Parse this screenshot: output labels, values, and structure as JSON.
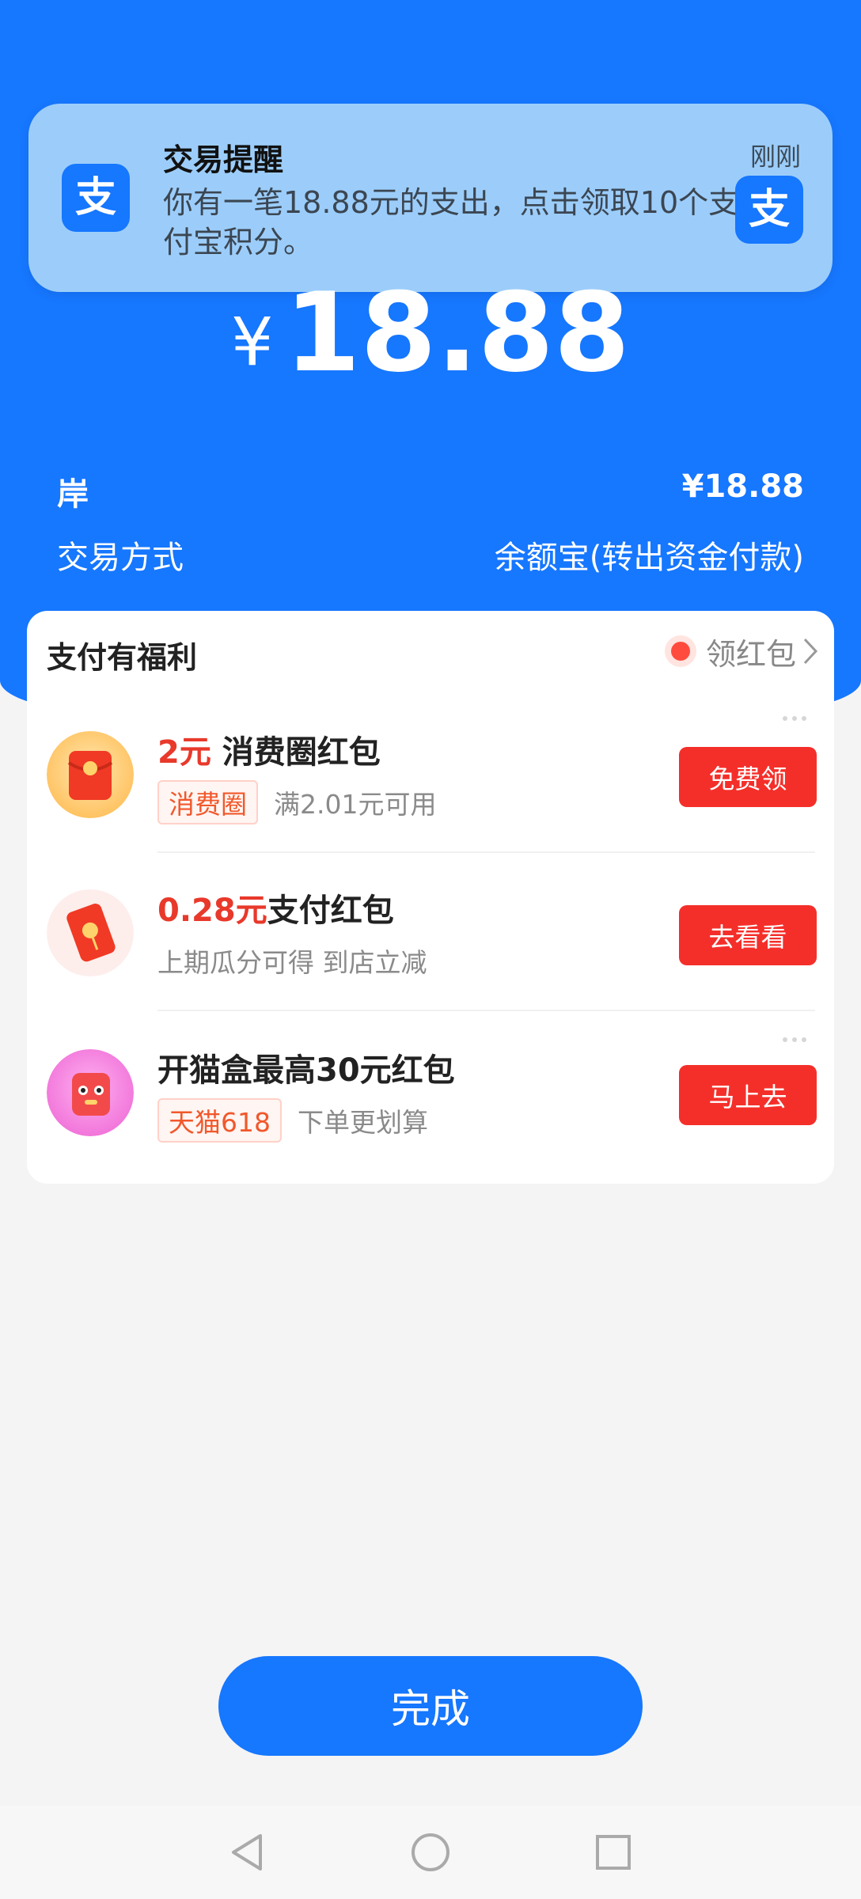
{
  "notification": {
    "app_icon": "alipay-icon",
    "title": "交易提醒",
    "time": "刚刚",
    "body": "你有一笔18.88元的支出，点击领取10个支付宝积分。"
  },
  "amount": {
    "currency": "¥",
    "value": "18.88"
  },
  "details": {
    "row1_label": "岸",
    "row1_value": "¥18.88",
    "row2_label": "交易方式",
    "row2_value": "余额宝(转出资金付款)"
  },
  "benefits": {
    "title": "支付有福利",
    "link_label": "领红包",
    "items": [
      {
        "amount": "2元",
        "title": " 消费圈红包",
        "tag": "消费圈",
        "desc": "满2.01元可用",
        "button": "免费领"
      },
      {
        "amount": "0.28元",
        "title": "支付红包",
        "tag": "",
        "desc": "上期瓜分可得 到店立减",
        "button": "去看看"
      },
      {
        "amount": "",
        "title": "开猫盒最高30元红包",
        "tag": "天猫618",
        "desc": "下单更划算",
        "button": "马上去"
      }
    ]
  },
  "done_label": "完成",
  "colors": {
    "brand_blue": "#1677ff",
    "accent_red": "#f42f2a",
    "background": "#f4f4f5"
  },
  "nav": {
    "back": "back-triangle-icon",
    "home": "home-circle-icon",
    "recents": "recents-square-icon"
  }
}
